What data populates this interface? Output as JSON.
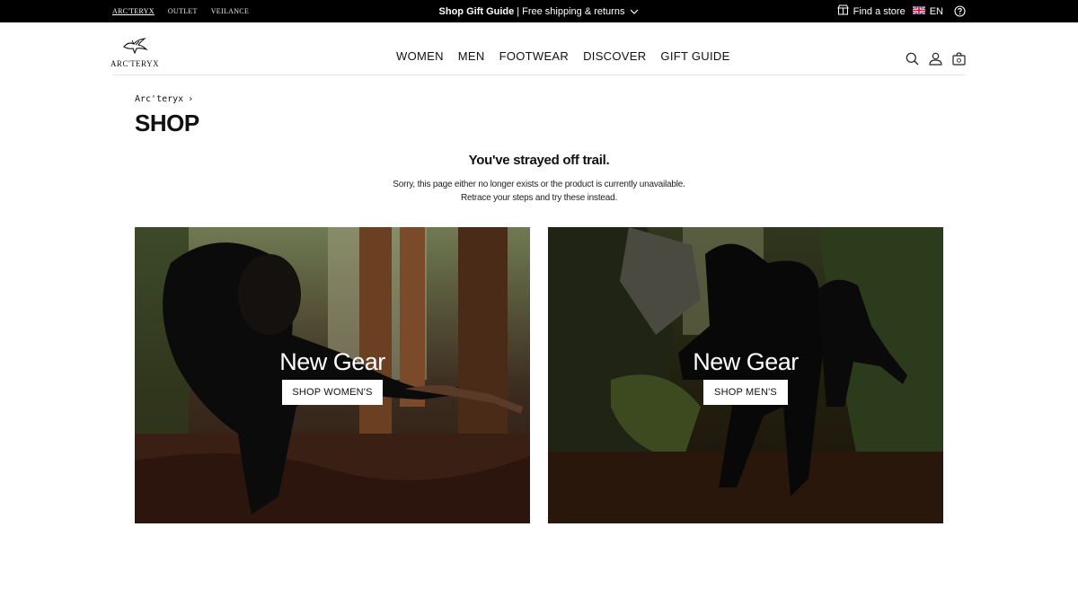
{
  "utility": {
    "brands": [
      "ARC'TERYX",
      "OUTLET",
      "VEILANCE"
    ],
    "promo_bold": "Shop Gift Guide",
    "promo_sep": "|",
    "promo_rest": "Free shipping & returns",
    "find_store": "Find a store",
    "language": "EN"
  },
  "header": {
    "logo_text": "ARC'TERYX",
    "nav": [
      "WOMEN",
      "MEN",
      "FOOTWEAR",
      "DISCOVER",
      "GIFT GUIDE"
    ]
  },
  "breadcrumb": {
    "home": "Arc'teryx",
    "separator": "›"
  },
  "page": {
    "title": "SHOP"
  },
  "message": {
    "heading": "You've strayed off trail.",
    "line1": "Sorry, this page either no longer exists or the product is currently unavailable.",
    "line2": "Retrace your steps and try these instead."
  },
  "cards": [
    {
      "headline": "New Gear",
      "cta": "SHOP WOMEN'S"
    },
    {
      "headline": "New Gear",
      "cta": "SHOP MEN'S"
    }
  ],
  "icons": {
    "store": "store-icon",
    "flag": "uk-flag-icon",
    "help": "help-icon",
    "search": "search-icon",
    "account": "account-icon",
    "bag": "bag-icon",
    "chevron": "chevron-down-icon"
  },
  "colors": {
    "utility_bg": "#000000",
    "page_bg": "#ffffff",
    "text": "#111111"
  }
}
